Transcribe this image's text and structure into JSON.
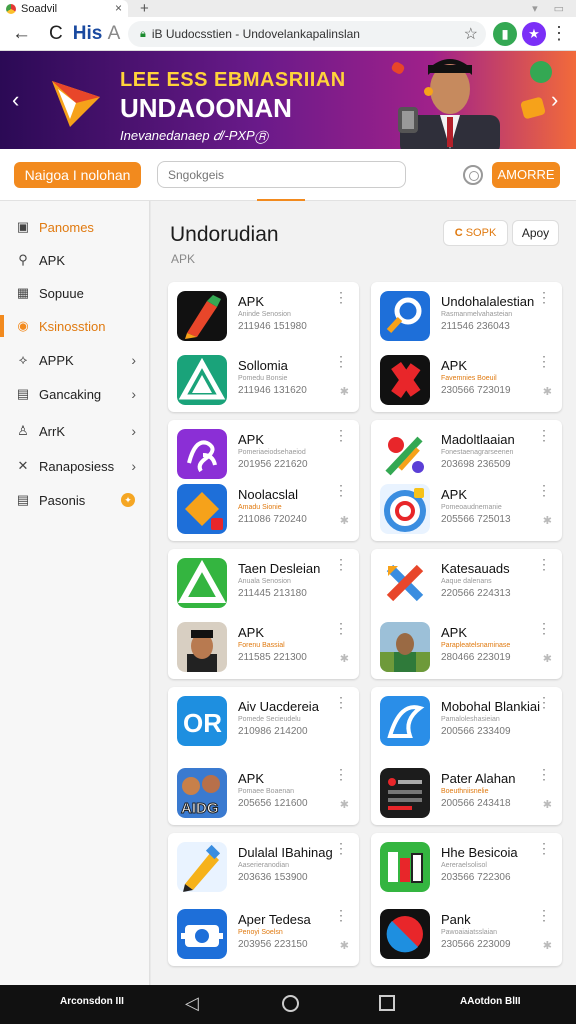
{
  "browser": {
    "tab_title": "Soadvil",
    "new_tab": "+",
    "back_icon": "←",
    "reload_label": "C",
    "title_main": "His",
    "title_suffix": "A",
    "url": "iB Uudocsstien - Undovelankapalinslan",
    "star_icon": "☆",
    "menu_icon": "⋮"
  },
  "banner": {
    "line1": "LEE ESS EBMASRIIAN",
    "line2": "UNDAOONAN",
    "line3": "Inevanedanaep 𝑑/-PXPⓇ",
    "prev": "‹",
    "next": "›"
  },
  "search": {
    "category_button": "Naigoa I nolohan",
    "placeholder": "Sngokgeis",
    "more_button": "AMORRE"
  },
  "sidebar": {
    "items": [
      {
        "label": "Panomes",
        "icon": "▣",
        "active": false,
        "accent": true
      },
      {
        "label": "APK",
        "icon": "⚲",
        "active": false
      },
      {
        "label": "Sopuue",
        "icon": "▦",
        "active": false
      },
      {
        "label": "Ksinosstion",
        "icon": "◉",
        "active": true
      },
      {
        "label": "APPK",
        "icon": "⟡",
        "chevron": "›"
      },
      {
        "label": "Gancaking",
        "icon": "▤",
        "chevron": "›"
      },
      {
        "label": "ArrK",
        "icon": "♙",
        "chevron": "›"
      },
      {
        "label": "Ranaposiess",
        "icon": "✕",
        "chevron": "›"
      },
      {
        "label": "Pasonis",
        "icon": "▤",
        "badge": "✦"
      }
    ]
  },
  "main": {
    "title": "Undorudian",
    "subtitle": "APK",
    "sort_button": "SOPK",
    "apply_button": "Apoy"
  },
  "cards": [
    [
      {
        "name": "APK",
        "dev": "Aninde Senosion",
        "meta": "211946 151980",
        "icon": "pen"
      },
      {
        "name": "Sollomia",
        "dev": "Pomedu Bonsie",
        "meta": "211946 131620",
        "icon": "triangle-green"
      }
    ],
    [
      {
        "name": "Undohalalestian",
        "dev": "Rasmanmelvahasteian",
        "meta": "211546 236043",
        "icon": "search-blue"
      },
      {
        "name": "APK",
        "dev": "Favemnies Boeuil",
        "meta": "230566 723019",
        "icon": "cross-red"
      }
    ],
    [
      {
        "name": "APK",
        "dev": "Pomeriaeiodsehaeiod",
        "meta": "201956 221620",
        "icon": "purple-script"
      },
      {
        "name": "Noolacslal",
        "dev": "Amadu Sionie",
        "meta": "211086 720240",
        "icon": "orange-diamond"
      }
    ],
    [
      {
        "name": "Madoltlaaian",
        "dev": "Fonestaenagrarseenen",
        "meta": "203698 236509",
        "icon": "colorful-check"
      },
      {
        "name": "APK",
        "dev": "Pomeoaudnemanie",
        "meta": "205566 725013",
        "icon": "target"
      }
    ],
    [
      {
        "name": "Taen Desleian",
        "dev": "Anuala Senosion",
        "meta": "211445 213180",
        "icon": "triangle-green2"
      },
      {
        "name": "APK",
        "dev": "Forenu Bassial",
        "meta": "211585 221300",
        "icon": "portrait-man"
      }
    ],
    [
      {
        "name": "Katesauads",
        "dev": "Aaque dalenans",
        "meta": "220566 224313",
        "icon": "x-colorful"
      },
      {
        "name": "APK",
        "dev": "Parapleatelsnaminase",
        "meta": "280466 223019",
        "icon": "portrait-field"
      }
    ],
    [
      {
        "name": "Aiv Uacdereia",
        "dev": "Pomede Secieudelu",
        "meta": "210986 214200",
        "icon": "or-blue"
      },
      {
        "name": "APK",
        "dev": "Pomaee Boaenan",
        "meta": "205656 121600",
        "icon": "game-aid"
      }
    ],
    [
      {
        "name": "Mobohal Blankiai",
        "dev": "Pamaloleshasieian",
        "meta": "200566 233409",
        "icon": "blue-swirl"
      },
      {
        "name": "Pater Alahan",
        "dev": "Boeuthniisnelie",
        "meta": "200566 243418",
        "icon": "dark-list"
      }
    ],
    [
      {
        "name": "Dulalal IBahinag",
        "dev": "Aaserieranodian",
        "meta": "203636 153900",
        "icon": "pencil-yellow"
      },
      {
        "name": "Aper Tedesa",
        "dev": "Penoyi Soelsn",
        "meta": "203956 223150",
        "icon": "camera-blue"
      }
    ],
    [
      {
        "name": "Hhe Besicoia",
        "dev": "Aereraelsolisol",
        "meta": "203566 722306",
        "icon": "bars-green"
      },
      {
        "name": "Pank",
        "dev": "Pawoaiaiatsslaian",
        "meta": "230566 223009",
        "icon": "red-blue-circle"
      }
    ]
  ],
  "navbar": {
    "left_text": "Arconsdon III",
    "right_text": "AAotdon BlII",
    "back": "◁"
  },
  "colors": {
    "accent": "#f28a1e",
    "banner_start": "#2b0a55",
    "banner_end": "#f26a3a"
  }
}
